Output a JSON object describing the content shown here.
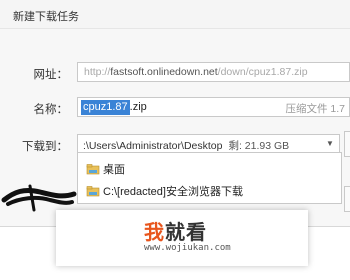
{
  "dialog": {
    "title": "新建下载任务",
    "url_label": "网址：",
    "url_prefix": "http://",
    "url_host": "fastsoft.onlinedown.net",
    "url_path": "/down/cpuz1.87.zip",
    "name_label": "名称：",
    "name_selected": "cpuz1.87",
    "name_ext": ".zip",
    "file_type": "压缩文件 1.7",
    "saveto_label": "下载到：",
    "save_path": ":\\Users\\Administrator\\Desktop",
    "free_space": "剩: 21.93 GB",
    "dropdown": [
      {
        "label": "桌面"
      },
      {
        "label": "C:\\[redacted]安全浏览器下载"
      }
    ]
  },
  "watermark": {
    "logo_a": "我",
    "logo_b": "就看",
    "url": "www.wojiukan.com"
  }
}
